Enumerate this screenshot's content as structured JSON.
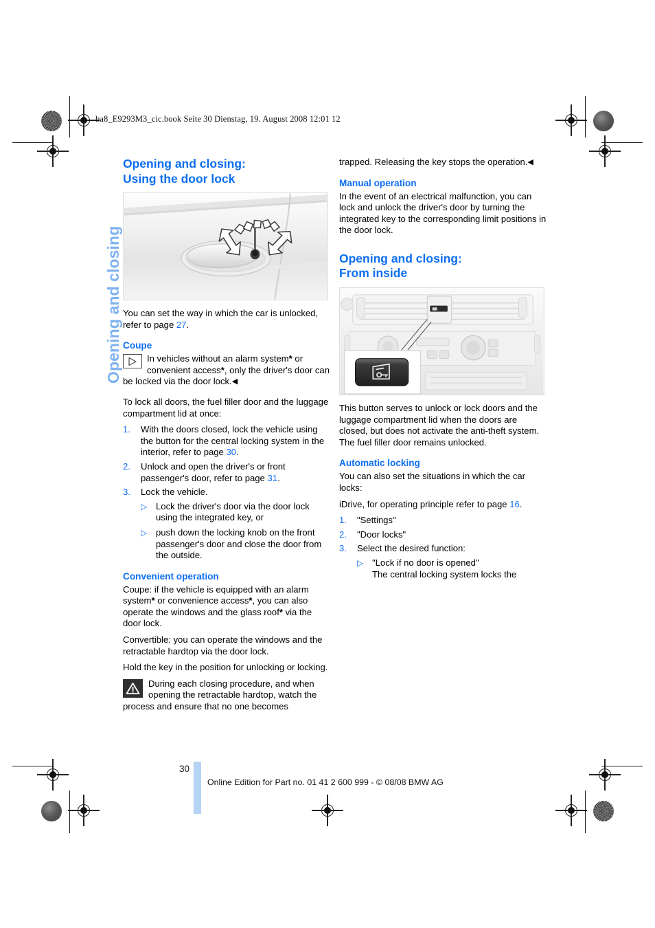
{
  "document": {
    "book_header": "ba8_E9293M3_cic.book  Seite 30  Dienstag, 19. August 2008  12:01 12",
    "side_tab": "Opening and closing",
    "page_number": "30",
    "footer": "Online Edition for Part no. 01 41 2 600 999 - © 08/08 BMW AG",
    "colors": {
      "heading_blue": "#0c6ef2",
      "side_tab_blue": "#7fb2ee",
      "footer_bar_blue": "#b4d3f5"
    }
  },
  "left_column": {
    "title_line1": "Opening and closing:",
    "title_line2": "Using the door lock",
    "figure_door_lock": {
      "caption_code": "",
      "alt": "Car door handle with integrated key lock and rotation arrows"
    },
    "intro": "You can set the way in which the car is unlocked, refer to page ",
    "intro_ref": "27",
    "intro_end": ".",
    "coupe_heading": "Coupe",
    "note_text_1": "In vehicles without an alarm system",
    "note_star_1": "*",
    "note_text_2": " or convenient access",
    "note_star_2": "*",
    "note_text_3": ", only the driver's door can be locked via the door lock.",
    "note_endmark": "◀",
    "lock_all_intro": "To lock all doors, the fuel filler door and the luggage compartment lid at once:",
    "steps": [
      {
        "num": "1.",
        "text_before": "With the doors closed, lock the vehicle using the button for the central locking system in the interior, refer to page ",
        "ref": "30",
        "text_after": "."
      },
      {
        "num": "2.",
        "text_before": "Unlock and open the driver's or front passenger's door, refer to page ",
        "ref": "31",
        "text_after": "."
      },
      {
        "num": "3.",
        "text_before": "Lock the vehicle.",
        "ref": "",
        "text_after": "",
        "subs": [
          "Lock the driver's door via the door lock using the integrated key, or",
          "push down the locking knob on the front passenger's door and close the door from the outside."
        ]
      }
    ],
    "convenient_heading": "Convenient operation",
    "convenient_p1_a": "Coupe: if the vehicle is equipped with an alarm system",
    "convenient_p1_star1": "*",
    "convenient_p1_b": " or convenience access",
    "convenient_p1_star2": "*",
    "convenient_p1_c": ", you can also operate the windows and the glass roof",
    "convenient_p1_star3": "*",
    "convenient_p1_d": " via the door lock.",
    "convenient_p2": "Convertible: you can operate the windows and the retractable hardtop via the door lock.",
    "convenient_p3": "Hold the key in the position for unlocking or locking.",
    "warning_text": "During each closing procedure, and when opening the retractable hardtop, watch the process and ensure that no one becomes"
  },
  "right_column": {
    "continued_text": "trapped. Releasing the key stops the operation.",
    "continued_endmark": "◀",
    "manual_heading": "Manual operation",
    "manual_text": "In the event of an electrical malfunction, you can lock and unlock the driver's door by turning the integrated key to the corresponding limit positions in the door lock.",
    "title_line1": "Opening and closing:",
    "title_line2": "From inside",
    "figure_console": {
      "caption_code": "",
      "alt": "Center console with callout of central locking button showing door and key symbol"
    },
    "button_text": "This button serves to unlock or lock doors and the luggage compartment lid when the doors are closed, but does not activate the anti-theft system. The fuel filler door remains unlocked.",
    "auto_heading": "Automatic locking",
    "auto_text": "You can also set the situations in which the car locks:",
    "idrive_text_before": "iDrive, for operating principle refer to page ",
    "idrive_ref": "16",
    "idrive_text_after": ".",
    "steps": [
      {
        "num": "1.",
        "text": "\"Settings\""
      },
      {
        "num": "2.",
        "text": "\"Door locks\""
      },
      {
        "num": "3.",
        "text": "Select the desired function:"
      }
    ],
    "sub_item_title": "\"Lock if no door is opened\"",
    "sub_item_body": "The central locking system locks the"
  }
}
